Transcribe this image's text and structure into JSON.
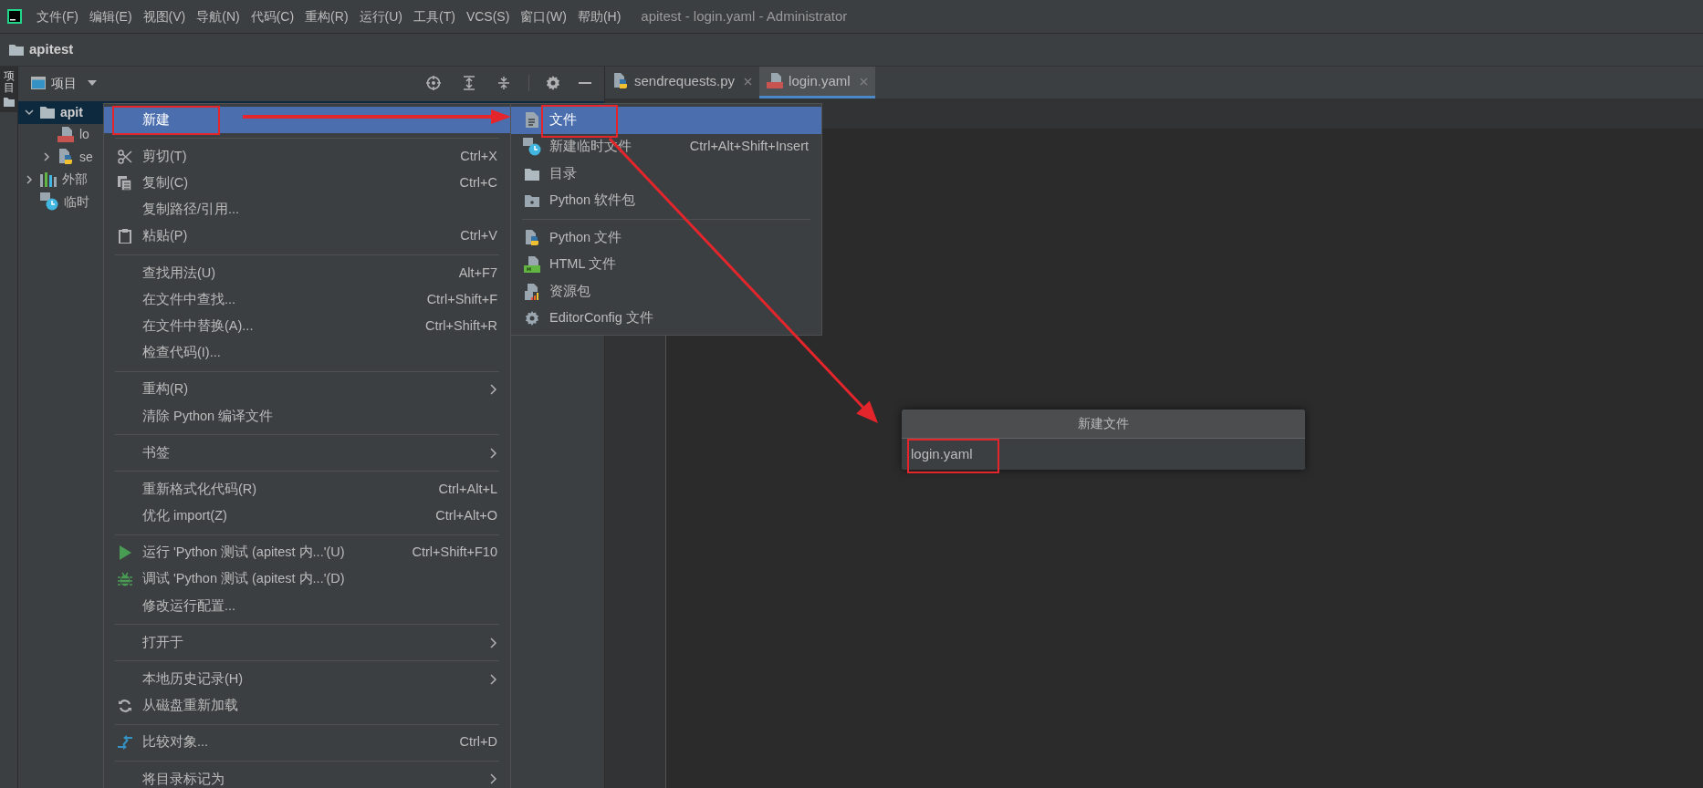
{
  "menu_bar": {
    "items": [
      "文件(F)",
      "编辑(E)",
      "视图(V)",
      "导航(N)",
      "代码(C)",
      "重构(R)",
      "运行(U)",
      "工具(T)",
      "VCS(S)",
      "窗口(W)",
      "帮助(H)"
    ]
  },
  "window": {
    "title": "apitest - login.yaml - Administrator"
  },
  "breadcrumb": "apitest",
  "side_strip": {
    "tab": "项目",
    "selected": true
  },
  "project_panel": {
    "title": "项目",
    "tree": [
      {
        "kind": "folder",
        "label": "apit",
        "expanded": true,
        "selected": true,
        "children": [
          {
            "kind": "yaml",
            "label": "lo",
            "selected": false
          },
          {
            "kind": "python",
            "label": "se",
            "expanded": false,
            "selected": false
          }
        ]
      },
      {
        "kind": "library",
        "label": "外部",
        "expanded": false,
        "selected": false
      },
      {
        "kind": "scratch",
        "label": "临时",
        "selected": false
      }
    ]
  },
  "editor_tabs": [
    {
      "kind": "python",
      "label": "sendrequests.py",
      "selected": false
    },
    {
      "kind": "yaml",
      "label": "login.yaml",
      "selected": true
    }
  ],
  "context_menu": [
    {
      "kind": "plain",
      "label": "新建",
      "selected": true,
      "submenu": false
    },
    {
      "kind": "separator"
    },
    {
      "kind": "cut",
      "label": "剪切(T)",
      "shortcut": "Ctrl+X",
      "selected": false,
      "submenu": false
    },
    {
      "kind": "copy",
      "label": "复制(C)",
      "shortcut": "Ctrl+C",
      "selected": false,
      "submenu": false
    },
    {
      "kind": "plain",
      "label": "复制路径/引用...",
      "selected": false,
      "submenu": false
    },
    {
      "kind": "paste",
      "label": "粘贴(P)",
      "shortcut": "Ctrl+V",
      "selected": false,
      "submenu": false
    },
    {
      "kind": "separator"
    },
    {
      "kind": "plain",
      "label": "查找用法(U)",
      "shortcut": "Alt+F7",
      "selected": false,
      "submenu": false
    },
    {
      "kind": "plain",
      "label": "在文件中查找...",
      "shortcut": "Ctrl+Shift+F",
      "selected": false,
      "submenu": false
    },
    {
      "kind": "plain",
      "label": "在文件中替换(A)...",
      "shortcut": "Ctrl+Shift+R",
      "selected": false,
      "submenu": false
    },
    {
      "kind": "plain",
      "label": "检查代码(I)...",
      "selected": false,
      "submenu": false
    },
    {
      "kind": "separator"
    },
    {
      "kind": "plain",
      "label": "重构(R)",
      "selected": false,
      "submenu": true
    },
    {
      "kind": "plain",
      "label": "清除 Python 编译文件",
      "selected": false,
      "submenu": false
    },
    {
      "kind": "separator"
    },
    {
      "kind": "plain",
      "label": "书签",
      "selected": false,
      "submenu": true
    },
    {
      "kind": "separator"
    },
    {
      "kind": "plain",
      "label": "重新格式化代码(R)",
      "shortcut": "Ctrl+Alt+L",
      "selected": false,
      "submenu": false
    },
    {
      "kind": "plain",
      "label": "优化 import(Z)",
      "shortcut": "Ctrl+Alt+O",
      "selected": false,
      "submenu": false
    },
    {
      "kind": "separator"
    },
    {
      "kind": "run",
      "label": "运行 'Python 测试 (apitest 内...'(U)",
      "shortcut": "Ctrl+Shift+F10",
      "selected": false,
      "submenu": false
    },
    {
      "kind": "debug",
      "label": "调试 'Python 测试 (apitest 内...'(D)",
      "selected": false,
      "submenu": false
    },
    {
      "kind": "plain",
      "label": "修改运行配置...",
      "selected": false,
      "submenu": false
    },
    {
      "kind": "separator"
    },
    {
      "kind": "plain",
      "label": "打开于",
      "selected": false,
      "submenu": true
    },
    {
      "kind": "separator"
    },
    {
      "kind": "plain",
      "label": "本地历史记录(H)",
      "selected": false,
      "submenu": true
    },
    {
      "kind": "reload",
      "label": "从磁盘重新加载",
      "selected": false,
      "submenu": false
    },
    {
      "kind": "separator"
    },
    {
      "kind": "compare",
      "label": "比较对象...",
      "shortcut": "Ctrl+D",
      "selected": false,
      "submenu": false
    },
    {
      "kind": "separator"
    },
    {
      "kind": "plain",
      "label": "将目录标记为",
      "selected": false,
      "submenu": true
    }
  ],
  "submenu": [
    {
      "kind": "file",
      "label": "文件",
      "selected": true
    },
    {
      "kind": "scratch",
      "label": "新建临时文件",
      "shortcut": "Ctrl+Alt+Shift+Insert",
      "selected": false
    },
    {
      "kind": "folder",
      "label": "目录",
      "selected": false
    },
    {
      "kind": "package",
      "label": "Python 软件包",
      "selected": false
    },
    {
      "kind": "separator"
    },
    {
      "kind": "python",
      "label": "Python 文件",
      "selected": false
    },
    {
      "kind": "html",
      "label": "HTML 文件",
      "selected": false
    },
    {
      "kind": "bundle",
      "label": "资源包",
      "selected": false
    },
    {
      "kind": "gear",
      "label": "EditorConfig 文件",
      "selected": false
    }
  ],
  "dialog": {
    "title": "新建文件",
    "value": "login.yaml"
  }
}
